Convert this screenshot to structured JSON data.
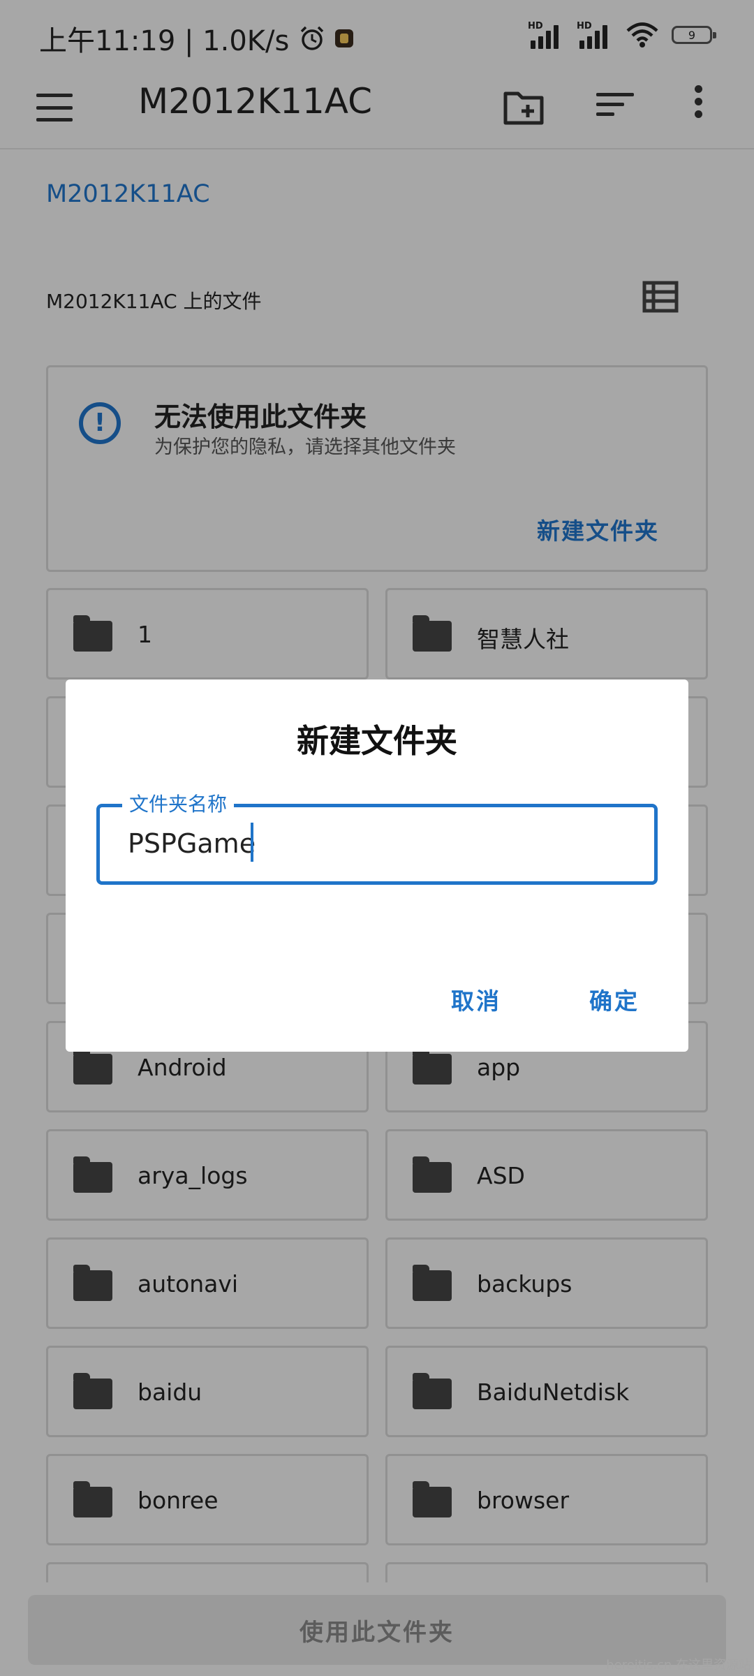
{
  "status_bar": {
    "time_speed": "上午11:19 | 1.0K/s",
    "signal_tag_1": "HD",
    "signal_tag_2": "HD",
    "battery": "9"
  },
  "app_bar": {
    "title": "M2012K11AC"
  },
  "breadcrumb": "M2012K11AC",
  "section_label": "M2012K11AC 上的文件",
  "warning": {
    "title": "无法使用此文件夹",
    "subtitle": "为保护您的隐私，请选择其他文件夹",
    "action": "新建文件夹"
  },
  "folders": [
    "1",
    "智慧人社",
    "Android",
    "app",
    "arya_logs",
    "ASD",
    "autonavi",
    "backups",
    "baidu",
    "BaiduNetdisk",
    "bonree",
    "browser"
  ],
  "bottom_button": "使用此文件夹",
  "dialog": {
    "title": "新建文件夹",
    "field_label": "文件夹名称",
    "field_value": "PSPGame",
    "cancel": "取消",
    "confirm": "确定"
  },
  "watermark": "hereitis.cn 在这里资源站",
  "colors": {
    "accent": "#1f74c9",
    "scrim": "rgba(0,0,0,0.32)"
  }
}
